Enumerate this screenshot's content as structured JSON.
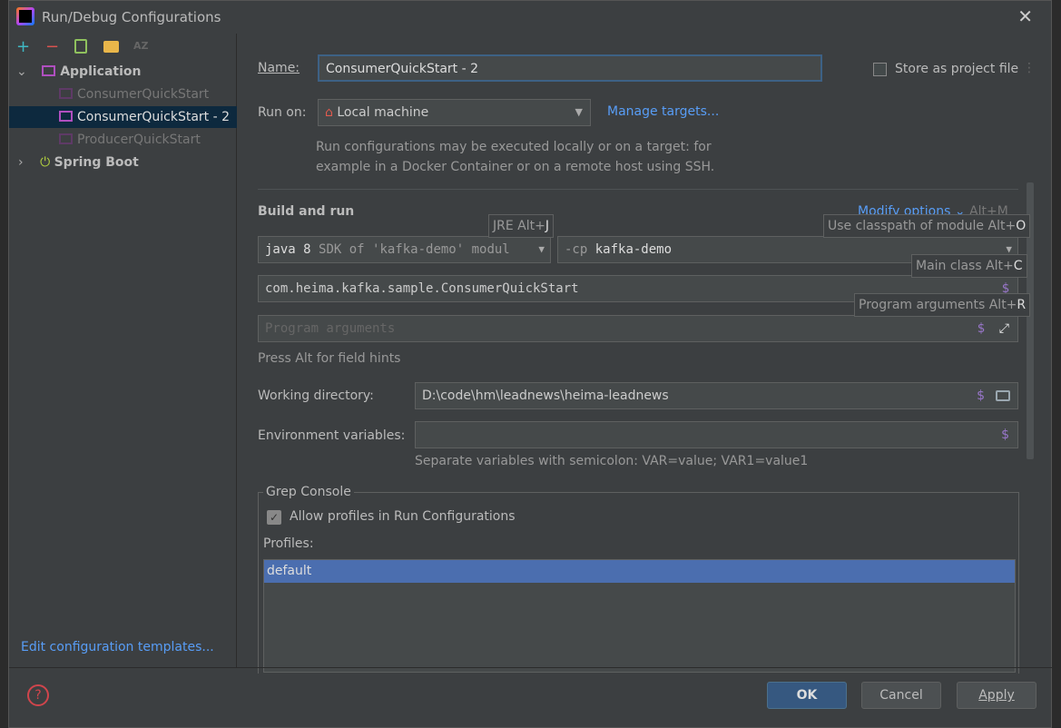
{
  "window": {
    "title": "Run/Debug Configurations"
  },
  "toolbar": {
    "add": "+",
    "remove": "−",
    "sort": "AZ"
  },
  "tree": {
    "application": "Application",
    "items": [
      "ConsumerQuickStart",
      "ConsumerQuickStart - 2",
      "ProducerQuickStart"
    ],
    "spring_boot": "Spring Boot"
  },
  "edit_templates": "Edit configuration templates...",
  "form": {
    "name_label": "Name:",
    "name_value": "ConsumerQuickStart - 2",
    "store_label": "Store as project file",
    "run_on_label": "Run on:",
    "run_on_value": "Local machine",
    "manage_targets": "Manage targets...",
    "run_on_desc1": "Run configurations may be executed locally or on a target: for",
    "run_on_desc2": "example in a Docker Container or on a remote host using SSH.",
    "build_run": "Build and run",
    "modify_options": "Modify options",
    "modify_shortcut": "Alt+M",
    "jre_prefix": "java 8",
    "jre_value": "SDK of 'kafka-demo' modul",
    "cp_prefix": "-cp",
    "cp_value": "kafka-demo",
    "main_class": "com.heima.kafka.sample.ConsumerQuickStart",
    "program_args_placeholder": "Program arguments",
    "field_hints": "Press Alt for field hints",
    "working_dir_label": "Working directory:",
    "working_dir_value": "D:\\code\\hm\\leadnews\\heima-leadnews",
    "env_label": "Environment variables:",
    "env_hint": "Separate variables with semicolon: VAR=value; VAR1=value1",
    "dollar": "$"
  },
  "tooltips": {
    "jre": "JRE Alt+",
    "jre_key": "J",
    "classpath": "Use classpath of module Alt+",
    "classpath_key": "O",
    "main": "Main class Alt+",
    "main_key": "C",
    "args": "Program arguments Alt+",
    "args_key": "R"
  },
  "grep": {
    "title": "Grep Console",
    "allow_profiles": "Allow profiles in Run Configurations",
    "allow_checked": true,
    "profiles_label": "Profiles:",
    "profiles": [
      "default"
    ]
  },
  "buttons": {
    "ok": "OK",
    "cancel": "Cancel",
    "apply": "Apply",
    "help": "?"
  }
}
